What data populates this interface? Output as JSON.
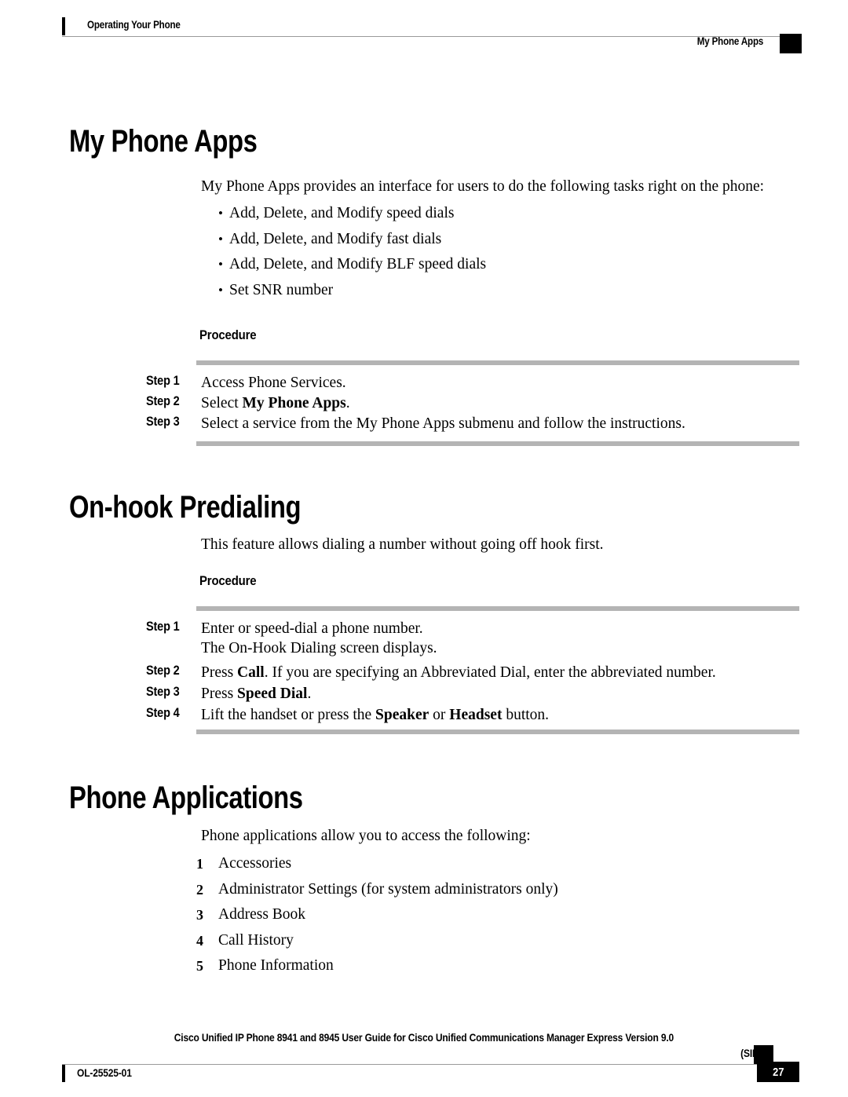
{
  "header": {
    "left_text": "Operating Your Phone",
    "right_text": "My Phone Apps"
  },
  "sections": [
    {
      "title": "My Phone Apps",
      "intro": "My Phone Apps provides an interface for users to do the following tasks right on the phone:",
      "bullets": [
        "Add, Delete, and Modify speed dials",
        "Add, Delete, and Modify fast dials",
        "Add, Delete, and Modify BLF speed dials",
        "Set SNR number"
      ],
      "procedure_label": "Procedure",
      "steps": [
        {
          "label": "Step 1",
          "text_html": "Access Phone Services."
        },
        {
          "label": "Step 2",
          "text_html": "Select <b>My Phone Apps</b>."
        },
        {
          "label": "Step 3",
          "text_html": "Select a service from the My Phone Apps submenu and follow the instructions."
        }
      ]
    },
    {
      "title": "On-hook Predialing",
      "intro": "This feature allows dialing a number without going off hook first.",
      "procedure_label": "Procedure",
      "steps": [
        {
          "label": "Step 1",
          "text_html": "Enter or speed-dial a phone number.<br>The On-Hook Dialing screen displays."
        },
        {
          "label": "Step 2",
          "text_html": "Press <b>Call</b>. If you are specifying an Abbreviated Dial, enter the abbreviated number."
        },
        {
          "label": "Step 3",
          "text_html": "Press <b>Speed Dial</b>."
        },
        {
          "label": "Step 4",
          "text_html": "Lift the handset or press the <b>Speaker</b> or <b>Headset</b> button."
        }
      ]
    },
    {
      "title": "Phone Applications",
      "intro": "Phone applications allow you to access the following:",
      "numbered": [
        {
          "num": "1",
          "text": "Accessories"
        },
        {
          "num": "2",
          "text": "Administrator Settings (for system administrators only)"
        },
        {
          "num": "3",
          "text": "Address Book"
        },
        {
          "num": "4",
          "text": "Call History"
        },
        {
          "num": "5",
          "text": "Phone Information"
        }
      ]
    }
  ],
  "footer": {
    "guide_title": "Cisco Unified IP Phone 8941 and 8945 User Guide for Cisco Unified Communications Manager Express Version 9.0",
    "protocol": "(SIP)",
    "doc_id": "OL-25525-01",
    "page_number": "27"
  },
  "colors": {
    "rule_gray": "#b4b4b4",
    "thin_rule": "#9a9a9a",
    "marker_black": "#000000"
  }
}
